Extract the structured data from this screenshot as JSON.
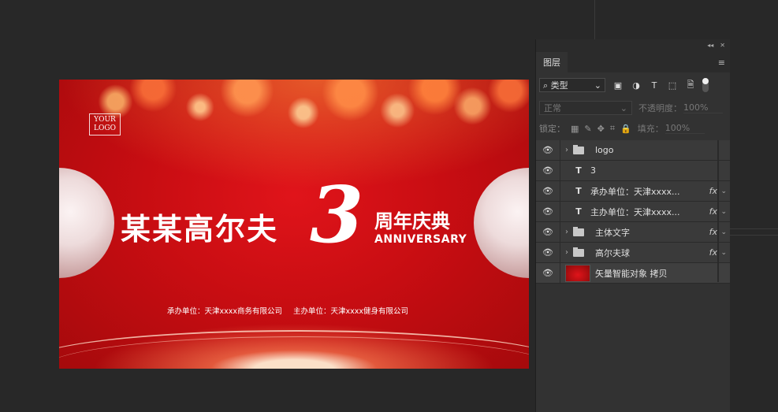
{
  "artwork": {
    "logo_line1": "YOUR",
    "logo_line2": "LOGO",
    "title": "某某高尔夫",
    "number": "3",
    "zhounian": "周年庆典",
    "anniversary": "ANNIVERSARY",
    "organizer": "承办单位：天津xxxx商务有限公司",
    "host": "主办单位：天津xxxx健身有限公司"
  },
  "panel": {
    "tab_label": "图层",
    "filter_kind": "类型",
    "blend_mode": "正常",
    "opacity_label": "不透明度：",
    "opacity_value": "100%",
    "lock_label": "锁定：",
    "fill_label": "填充：",
    "fill_value": "100%",
    "fx_label": "fx",
    "layers": [
      {
        "name": "logo",
        "type": "folder",
        "fx": false
      },
      {
        "name": "3",
        "type": "text",
        "fx": false
      },
      {
        "name": "承办单位：天津xxxx...",
        "type": "text",
        "fx": true
      },
      {
        "name": "主办单位：天津xxxx...",
        "type": "text",
        "fx": true
      },
      {
        "name": "主体文字",
        "type": "folder",
        "fx": true
      },
      {
        "name": "高尔夫球",
        "type": "folder",
        "fx": true
      },
      {
        "name": "矢量智能对象 拷贝",
        "type": "smart-object",
        "fx": false
      }
    ]
  }
}
